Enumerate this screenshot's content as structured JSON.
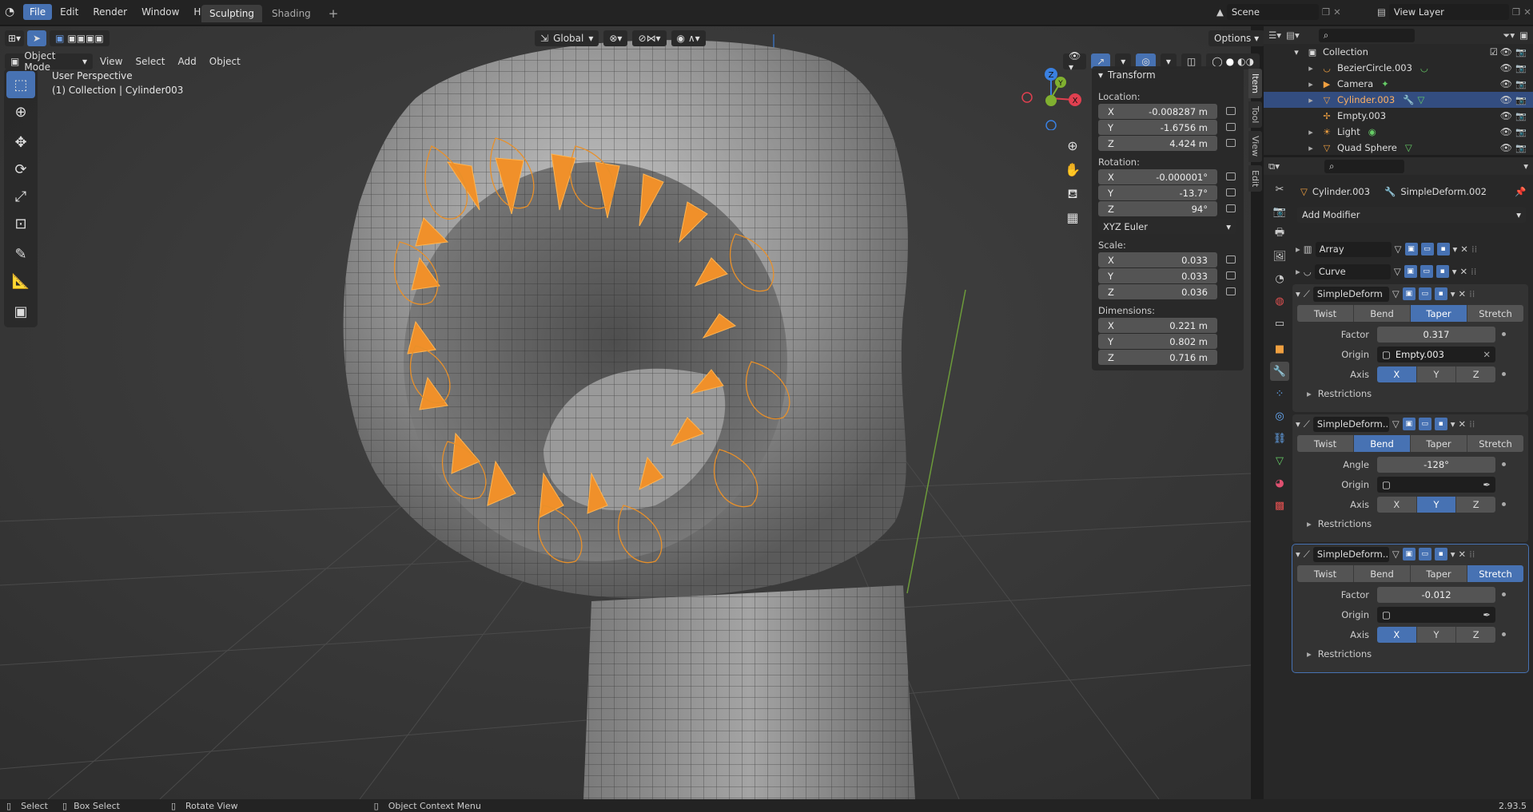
{
  "topbar": {
    "menus": [
      "File",
      "Edit",
      "Render",
      "Window",
      "Help"
    ],
    "workspaces": [
      "Sculpting",
      "Shading"
    ],
    "scene": "Scene",
    "view_layer": "View Layer"
  },
  "viewport_header": {
    "mode": "Object Mode",
    "menus": [
      "View",
      "Select",
      "Add",
      "Object"
    ],
    "transform_orientation": "Global",
    "options": "Options"
  },
  "viewport": {
    "perspective": "User Perspective",
    "collection_info": "(1) Collection | Cylinder003",
    "gizmo": {
      "x": "X",
      "y": "Y",
      "z": "Z"
    }
  },
  "npanel": {
    "title": "Transform",
    "location_label": "Location:",
    "location": [
      {
        "axis": "X",
        "value": "-0.008287 m"
      },
      {
        "axis": "Y",
        "value": "-1.6756 m"
      },
      {
        "axis": "Z",
        "value": "4.424 m"
      }
    ],
    "rotation_label": "Rotation:",
    "rotation": [
      {
        "axis": "X",
        "value": "-0.000001°"
      },
      {
        "axis": "Y",
        "value": "-13.7°"
      },
      {
        "axis": "Z",
        "value": "94°"
      }
    ],
    "rotation_mode": "XYZ Euler",
    "scale_label": "Scale:",
    "scale": [
      {
        "axis": "X",
        "value": "0.033"
      },
      {
        "axis": "Y",
        "value": "0.033"
      },
      {
        "axis": "Z",
        "value": "0.036"
      }
    ],
    "dimensions_label": "Dimensions:",
    "dimensions": [
      {
        "axis": "X",
        "value": "0.221 m"
      },
      {
        "axis": "Y",
        "value": "0.802 m"
      },
      {
        "axis": "Z",
        "value": "0.716 m"
      }
    ],
    "tabs": [
      "Item",
      "Tool",
      "View",
      "Edit"
    ]
  },
  "outliner": {
    "root": "Collection",
    "items": [
      "BezierCircle.003",
      "Camera",
      "Cylinder.003",
      "Empty.003",
      "Light",
      "Quad Sphere"
    ],
    "selected": "Cylinder.003"
  },
  "properties": {
    "object": "Cylinder.003",
    "modifier": "SimpleDeform.002",
    "add_modifier": "Add Modifier",
    "simple_modifiers": [
      "Array",
      "Curve"
    ],
    "modes": [
      "Twist",
      "Bend",
      "Taper",
      "Stretch"
    ],
    "axes": [
      "X",
      "Y",
      "Z"
    ],
    "restrictions": "Restrictions",
    "origin_label": "Origin",
    "axis_label": "Axis",
    "deform": [
      {
        "name": "SimpleDeform",
        "mode": "Taper",
        "param_label": "Factor",
        "param_value": "0.317",
        "origin": "Empty.003",
        "axis": "X"
      },
      {
        "name": "SimpleDeform...",
        "mode": "Bend",
        "param_label": "Angle",
        "param_value": "-128°",
        "origin": "",
        "axis": "Y"
      },
      {
        "name": "SimpleDeform...",
        "mode": "Stretch",
        "param_label": "Factor",
        "param_value": "-0.012",
        "origin": "",
        "axis": "X"
      }
    ]
  },
  "statusbar": {
    "select": "Select",
    "box_select": "Box Select",
    "rotate_view": "Rotate View",
    "context_menu": "Object Context Menu",
    "version": "2.93.5"
  },
  "colors": {
    "accent": "#4772b3",
    "selected_orange": "#f5a030",
    "axis_x": "#e04050",
    "axis_y": "#80b030",
    "axis_z": "#3a80e0"
  }
}
